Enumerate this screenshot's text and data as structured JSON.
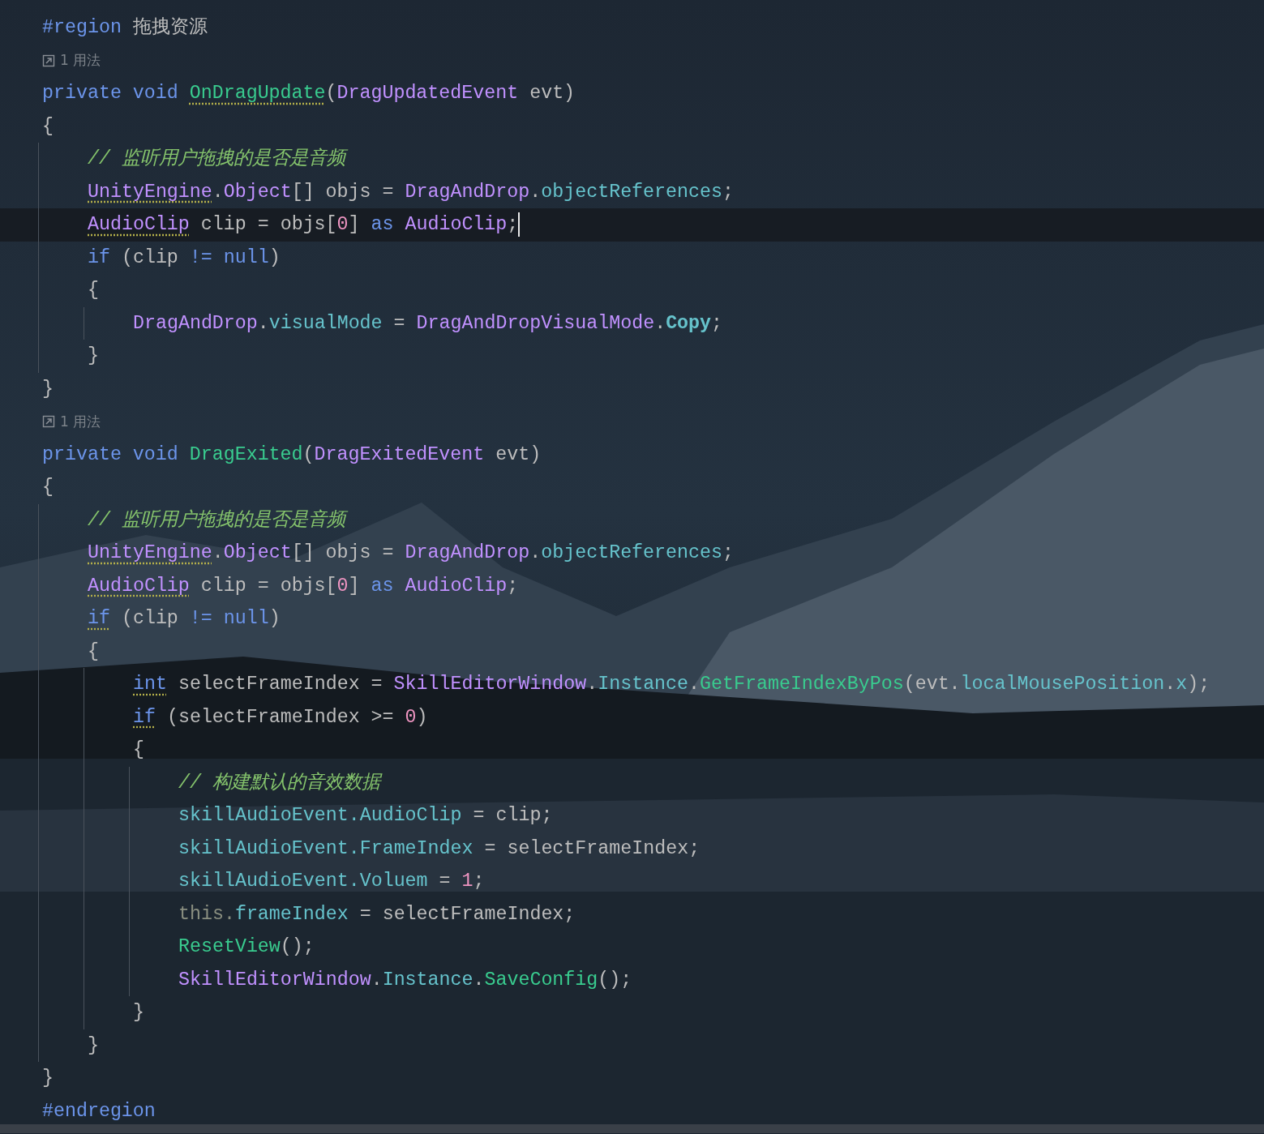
{
  "code": [
    {
      "kind": "line",
      "tokens": [
        {
          "text": "#region",
          "kind": "keyword"
        },
        {
          "text": " 拖拽资源",
          "kind": "plain"
        }
      ]
    },
    {
      "kind": "usage",
      "text": "1 用法"
    },
    {
      "kind": "line",
      "tokens": [
        {
          "text": "private void ",
          "kind": "keyword"
        },
        {
          "text": "OnDragUpdate",
          "kind": "method",
          "underline": true
        },
        {
          "text": "(",
          "kind": "plain"
        },
        {
          "text": "DragUpdatedEvent",
          "kind": "type"
        },
        {
          "text": " evt)",
          "kind": "plain"
        }
      ]
    },
    {
      "kind": "line",
      "tokens": [
        {
          "text": "{",
          "kind": "plain"
        }
      ]
    },
    {
      "kind": "block",
      "children": [
        {
          "kind": "line",
          "tokens": [
            {
              "text": "// 监听用户拖拽的是否是音频",
              "kind": "comment"
            }
          ]
        },
        {
          "kind": "line",
          "tokens": [
            {
              "text": "UnityEngine",
              "kind": "type",
              "underline": true
            },
            {
              "text": ".",
              "kind": "plain"
            },
            {
              "text": "Object",
              "kind": "type"
            },
            {
              "text": "[] objs = ",
              "kind": "plain"
            },
            {
              "text": "DragAndDrop",
              "kind": "type"
            },
            {
              "text": ".",
              "kind": "plain"
            },
            {
              "text": "objectReferences",
              "kind": "field"
            },
            {
              "text": ";",
              "kind": "plain"
            }
          ]
        },
        {
          "kind": "line",
          "current": true,
          "caret": true,
          "tokens": [
            {
              "text": "AudioClip",
              "kind": "type",
              "underline": true
            },
            {
              "text": " clip = objs[",
              "kind": "plain"
            },
            {
              "text": "0",
              "kind": "number"
            },
            {
              "text": "] ",
              "kind": "plain"
            },
            {
              "text": "as",
              "kind": "keyword"
            },
            {
              "text": " AudioClip",
              "kind": "type"
            },
            {
              "text": ";",
              "kind": "plain"
            }
          ]
        },
        {
          "kind": "line",
          "tokens": [
            {
              "text": "if",
              "kind": "keyword"
            },
            {
              "text": " (clip ",
              "kind": "plain"
            },
            {
              "text": "!=",
              "kind": "keyword"
            },
            {
              "text": " null",
              "kind": "keyword"
            },
            {
              "text": ")",
              "kind": "plain"
            }
          ]
        },
        {
          "kind": "line",
          "tokens": [
            {
              "text": "{",
              "kind": "plain"
            }
          ]
        },
        {
          "kind": "block",
          "children": [
            {
              "kind": "line",
              "tokens": [
                {
                  "text": "DragAndDrop",
                  "kind": "type"
                },
                {
                  "text": ".",
                  "kind": "plain"
                },
                {
                  "text": "visualMode",
                  "kind": "field"
                },
                {
                  "text": " = ",
                  "kind": "plain"
                },
                {
                  "text": "DragAndDropVisualMode",
                  "kind": "type"
                },
                {
                  "text": ".",
                  "kind": "plain"
                },
                {
                  "text": "Copy",
                  "kind": "enum"
                },
                {
                  "text": ";",
                  "kind": "plain"
                }
              ]
            }
          ]
        },
        {
          "kind": "line",
          "tokens": [
            {
              "text": "}",
              "kind": "plain"
            }
          ]
        }
      ]
    },
    {
      "kind": "line",
      "tokens": [
        {
          "text": "}",
          "kind": "plain"
        }
      ]
    },
    {
      "kind": "usage",
      "text": "1 用法"
    },
    {
      "kind": "line",
      "tokens": [
        {
          "text": "private void ",
          "kind": "keyword"
        },
        {
          "text": "DragExited",
          "kind": "method"
        },
        {
          "text": "(",
          "kind": "plain"
        },
        {
          "text": "DragExitedEvent",
          "kind": "type"
        },
        {
          "text": " evt)",
          "kind": "plain"
        }
      ]
    },
    {
      "kind": "line",
      "tokens": [
        {
          "text": "{",
          "kind": "plain"
        }
      ]
    },
    {
      "kind": "block",
      "children": [
        {
          "kind": "line",
          "tokens": [
            {
              "text": "// 监听用户拖拽的是否是音频",
              "kind": "comment"
            }
          ]
        },
        {
          "kind": "line",
          "tokens": [
            {
              "text": "UnityEngine",
              "kind": "type",
              "underline": true
            },
            {
              "text": ".",
              "kind": "plain"
            },
            {
              "text": "Object",
              "kind": "type"
            },
            {
              "text": "[] objs = ",
              "kind": "plain"
            },
            {
              "text": "DragAndDrop",
              "kind": "type"
            },
            {
              "text": ".",
              "kind": "plain"
            },
            {
              "text": "objectReferences",
              "kind": "field"
            },
            {
              "text": ";",
              "kind": "plain"
            }
          ]
        },
        {
          "kind": "line",
          "tokens": [
            {
              "text": "AudioClip",
              "kind": "type",
              "underline": true
            },
            {
              "text": " clip = objs[",
              "kind": "plain"
            },
            {
              "text": "0",
              "kind": "number"
            },
            {
              "text": "] ",
              "kind": "plain"
            },
            {
              "text": "as",
              "kind": "keyword"
            },
            {
              "text": " AudioClip",
              "kind": "type"
            },
            {
              "text": ";",
              "kind": "plain"
            }
          ]
        },
        {
          "kind": "line",
          "tokens": [
            {
              "text": "if",
              "kind": "keyword",
              "underline": true
            },
            {
              "text": " (clip ",
              "kind": "plain"
            },
            {
              "text": "!=",
              "kind": "keyword"
            },
            {
              "text": " null",
              "kind": "keyword"
            },
            {
              "text": ")",
              "kind": "plain"
            }
          ]
        },
        {
          "kind": "line",
          "tokens": [
            {
              "text": "{",
              "kind": "plain"
            }
          ]
        },
        {
          "kind": "block",
          "children": [
            {
              "kind": "line",
              "tokens": [
                {
                  "text": "int",
                  "kind": "keyword",
                  "underline": true
                },
                {
                  "text": " selectFrameIndex = ",
                  "kind": "plain"
                },
                {
                  "text": "SkillEditorWindow",
                  "kind": "type"
                },
                {
                  "text": ".",
                  "kind": "plain"
                },
                {
                  "text": "Instance",
                  "kind": "field"
                },
                {
                  "text": ".",
                  "kind": "plain"
                },
                {
                  "text": "GetFrameIndexByPos",
                  "kind": "method"
                },
                {
                  "text": "(evt.",
                  "kind": "plain"
                },
                {
                  "text": "localMousePosition",
                  "kind": "field"
                },
                {
                  "text": ".",
                  "kind": "plain"
                },
                {
                  "text": "x",
                  "kind": "field"
                },
                {
                  "text": ");",
                  "kind": "plain"
                }
              ]
            },
            {
              "kind": "line",
              "tokens": [
                {
                  "text": "if",
                  "kind": "keyword",
                  "underline": true
                },
                {
                  "text": " (selectFrameIndex >= ",
                  "kind": "plain"
                },
                {
                  "text": "0",
                  "kind": "number"
                },
                {
                  "text": ")",
                  "kind": "plain"
                }
              ]
            },
            {
              "kind": "line",
              "tokens": [
                {
                  "text": "{",
                  "kind": "plain"
                }
              ]
            },
            {
              "kind": "block",
              "children": [
                {
                  "kind": "line",
                  "tokens": [
                    {
                      "text": "// 构建默认的音效数据",
                      "kind": "comment"
                    }
                  ]
                },
                {
                  "kind": "line",
                  "tokens": [
                    {
                      "text": "skillAudioEvent.",
                      "kind": "field"
                    },
                    {
                      "text": "AudioClip",
                      "kind": "field"
                    },
                    {
                      "text": " = clip;",
                      "kind": "plain"
                    }
                  ]
                },
                {
                  "kind": "line",
                  "tokens": [
                    {
                      "text": "skillAudioEvent.",
                      "kind": "field"
                    },
                    {
                      "text": "FrameIndex",
                      "kind": "field"
                    },
                    {
                      "text": " = selectFrameIndex;",
                      "kind": "plain"
                    }
                  ]
                },
                {
                  "kind": "line",
                  "tokens": [
                    {
                      "text": "skillAudioEvent.",
                      "kind": "field"
                    },
                    {
                      "text": "Voluem",
                      "kind": "field"
                    },
                    {
                      "text": " = ",
                      "kind": "plain"
                    },
                    {
                      "text": "1",
                      "kind": "number"
                    },
                    {
                      "text": ";",
                      "kind": "plain"
                    }
                  ]
                },
                {
                  "kind": "line",
                  "tokens": [
                    {
                      "text": "this.",
                      "kind": "this"
                    },
                    {
                      "text": "frameIndex",
                      "kind": "field"
                    },
                    {
                      "text": " = selectFrameIndex;",
                      "kind": "plain"
                    }
                  ]
                },
                {
                  "kind": "line",
                  "tokens": [
                    {
                      "text": "ResetView",
                      "kind": "method"
                    },
                    {
                      "text": "();",
                      "kind": "plain"
                    }
                  ]
                },
                {
                  "kind": "line",
                  "tokens": [
                    {
                      "text": "SkillEditorWindow",
                      "kind": "type"
                    },
                    {
                      "text": ".",
                      "kind": "plain"
                    },
                    {
                      "text": "Instance",
                      "kind": "field"
                    },
                    {
                      "text": ".",
                      "kind": "plain"
                    },
                    {
                      "text": "SaveConfig",
                      "kind": "method"
                    },
                    {
                      "text": "();",
                      "kind": "plain"
                    }
                  ]
                }
              ]
            },
            {
              "kind": "line",
              "tokens": [
                {
                  "text": "}",
                  "kind": "plain"
                }
              ]
            }
          ]
        },
        {
          "kind": "line",
          "tokens": [
            {
              "text": "}",
              "kind": "plain"
            }
          ]
        }
      ]
    },
    {
      "kind": "line",
      "tokens": [
        {
          "text": "}",
          "kind": "plain"
        }
      ]
    },
    {
      "kind": "line",
      "tokens": [
        {
          "text": "#endregion",
          "kind": "keyword"
        }
      ]
    }
  ]
}
